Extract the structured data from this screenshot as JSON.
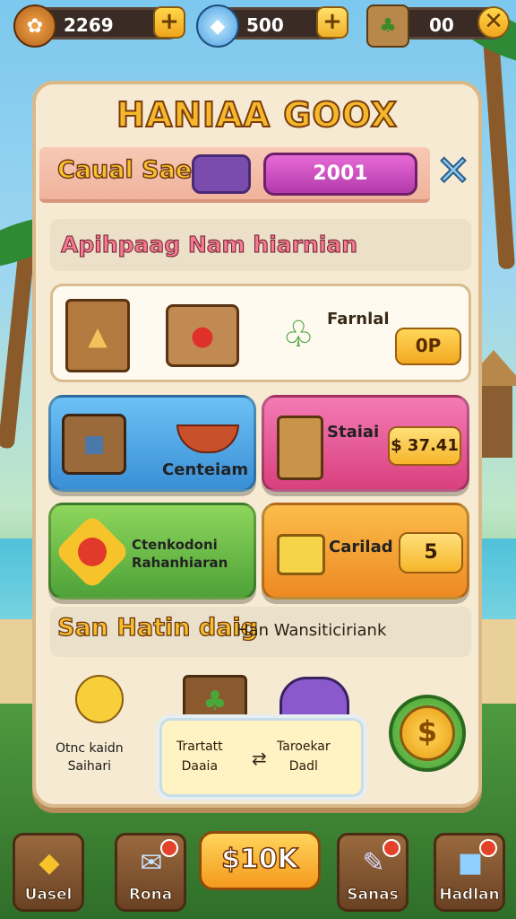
{
  "topbar": {
    "coins": "2269",
    "gems": "500",
    "supplies": "00"
  },
  "panel": {
    "title": "HANIAA GOOX",
    "header_label": "Caual Sae",
    "header_value": "2001",
    "sub_label": "Apihpaag Nam hiarnian",
    "items": {
      "side_label": "Farnlal",
      "button_label": "0P"
    },
    "tiles": [
      {
        "label": "Centeiam",
        "color": "#4aa7e6"
      },
      {
        "label": "Staiai",
        "price": "$ 37.41",
        "color": "#e8589a"
      },
      {
        "label": "Ctenkodoni\nRahanhiaran",
        "color": "#6cc046"
      },
      {
        "label": "Carilad",
        "price": "5",
        "color": "#f7a52b"
      }
    ],
    "lower_label_1": "San Hatin daig",
    "lower_label_2": "Han Wansiticiriank",
    "char_label": "Otnc kaidn\nSaihari",
    "reward_left": "Trartatt\nDaaia",
    "reward_right": "Taroekar\nDadl"
  },
  "nav": {
    "items": [
      {
        "label": "Uasel",
        "icon": "gem-icon"
      },
      {
        "label": "Rona",
        "icon": "letter-icon"
      },
      {
        "label": "Sanas",
        "icon": "pen-icon"
      },
      {
        "label": "Hadlan",
        "icon": "box-icon"
      }
    ],
    "center_label": "$10K"
  }
}
